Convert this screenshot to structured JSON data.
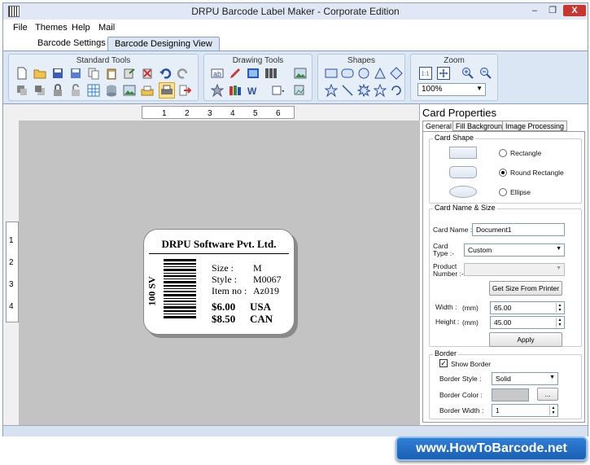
{
  "window": {
    "title": "DRPU Barcode Label Maker - Corporate Edition",
    "controls": [
      "–",
      "❐",
      "X"
    ]
  },
  "menu": [
    "File",
    "Themes",
    "Help",
    "Mail"
  ],
  "tabs": [
    "Barcode Settings",
    "Barcode Designing View"
  ],
  "ribbon": {
    "standard_tools": "Standard Tools",
    "drawing_tools": "Drawing Tools",
    "shapes": "Shapes",
    "zoom": "Zoom",
    "zoom_value": "100%"
  },
  "ruler": {
    "h": [
      "1",
      "2",
      "3",
      "4",
      "5",
      "6"
    ],
    "v": [
      "1",
      "2",
      "3",
      "4"
    ]
  },
  "card": {
    "title": "DRPU Software Pvt. Ltd.",
    "vertical_text": "100 SV",
    "size_label": "Size :",
    "size_value": "M",
    "style_label": "Style :",
    "style_value": "M0067",
    "item_label": "Item no :",
    "item_value": "Az019",
    "price1": "$6.00",
    "country1": "USA",
    "price2": "$8.50",
    "country2": "CAN"
  },
  "props": {
    "title": "Card Properties",
    "tabs": [
      "General",
      "Fill Background",
      "Image Processing"
    ],
    "card_shape": "Card Shape",
    "shapes": [
      "Rectangle",
      "Round Rectangle",
      "Ellipse"
    ],
    "selected_shape": "Round Rectangle",
    "name_size": "Card  Name & Size",
    "card_name_label": "Card Name :",
    "card_name": "Document1",
    "card_type_label1": "Card",
    "card_type_label2": "Type :-",
    "card_type": "Custom",
    "product_label1": "Product",
    "product_label2": "Number :-",
    "get_size": "Get Size From Printer",
    "width_label": "Width :",
    "height_label": "Height :",
    "unit": "(mm)",
    "width": "65.00",
    "height": "45.00",
    "apply": "Apply",
    "border": "Border",
    "show_border": "Show Border",
    "show_border_checked": true,
    "border_style_label": "Border Style :",
    "border_style": "Solid",
    "border_color_label": "Border Color :",
    "border_width_label": "Border Width :",
    "border_width": "1",
    "ellipsis": "..."
  },
  "watermark": "www.HowToBarcode.net",
  "colors": {
    "accent": "#1a5fb3",
    "ribbon": "#dbe6f4",
    "canvas": "#c3c3c3"
  }
}
